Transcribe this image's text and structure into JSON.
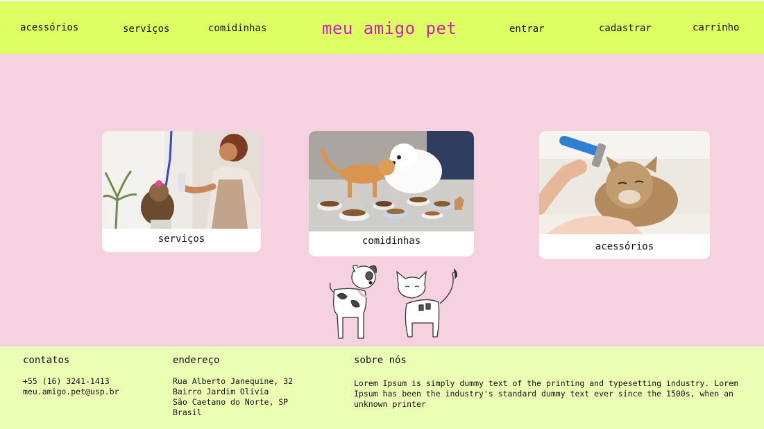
{
  "header": {
    "nav_left": [
      "acessórios",
      "serviços",
      "comidinhas"
    ],
    "brand": "meu amigo pet",
    "nav_right": [
      "entrar",
      "cadastrar",
      "carrinho"
    ],
    "colors": {
      "bar": "#ddff61",
      "brand": "#d01fb8"
    }
  },
  "cards": [
    {
      "label": "serviços",
      "image": "grooming-dog-photo"
    },
    {
      "label": "comidinhas",
      "image": "cat-and-dog-with-food-bowls-photo"
    },
    {
      "label": "acessórios",
      "image": "brushing-cat-photo"
    }
  ],
  "illustration": "dog-and-cat-cartoon",
  "footer": {
    "contatos": {
      "title": "contatos",
      "phone": "+55 (16) 3241-1413",
      "email": "meu.amigo.pet@usp.br"
    },
    "endereco": {
      "title": "endereço",
      "lines": "Rua Alberto Janequine, 32\nBairro Jardim Olivia\nSão Caetano do Norte, SP\nBrasil"
    },
    "sobre": {
      "title": "sobre nós",
      "text": "Lorem Ipsum is simply dummy text of the printing and typesetting industry. Lorem Ipsum has been the industry's standard dummy text ever since the 1500s, when an unknown printer"
    }
  },
  "colors": {
    "page_bg": "#f6d2e0",
    "footer_bg": "#eaffb3"
  }
}
